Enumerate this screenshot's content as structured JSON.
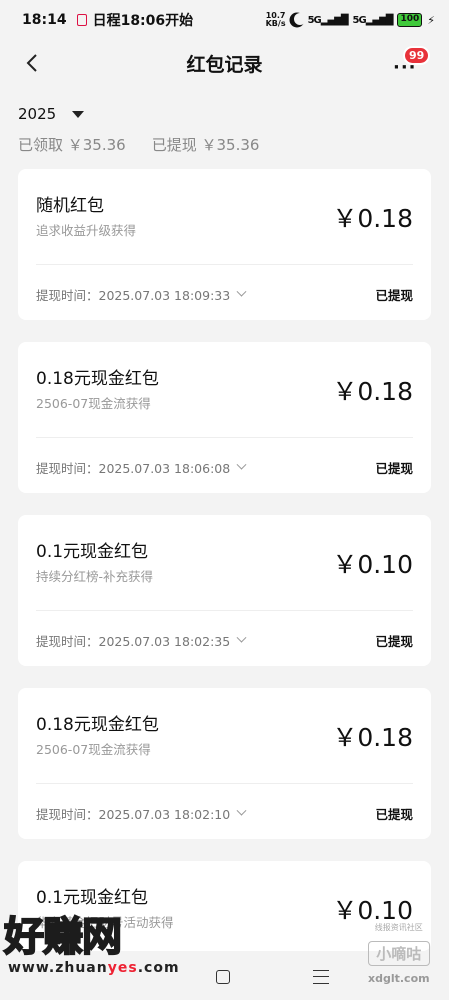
{
  "status_bar": {
    "time": "18:14",
    "notice": "日程18:06开始",
    "net_speed_value": "10.7",
    "net_speed_unit": "KB/s",
    "signal_1": "5G",
    "signal_2": "5G",
    "battery": "100"
  },
  "header": {
    "title": "红包记录",
    "badge_count": "99"
  },
  "filter": {
    "year": "2025"
  },
  "summary": {
    "received": "已领取 ￥35.36",
    "withdrawn": "已提现 ￥35.36"
  },
  "records": [
    {
      "title": "随机红包",
      "source": "追求收益升级获得",
      "amount": "￥0.18",
      "time": "提现时间：2025.07.03 18:09:33",
      "status": "已提现"
    },
    {
      "title": "0.18元现金红包",
      "source": "2506-07现金流获得",
      "amount": "￥0.18",
      "time": "提现时间：2025.07.03 18:06:08",
      "status": "已提现"
    },
    {
      "title": "0.1元现金红包",
      "source": "持续分红榜-补充获得",
      "amount": "￥0.10",
      "time": "提现时间：2025.07.03 18:02:35",
      "status": "已提现"
    },
    {
      "title": "0.18元现金红包",
      "source": "2506-07现金流获得",
      "amount": "￥0.18",
      "time": "提现时间：2025.07.03 18:02:10",
      "status": "已提现"
    },
    {
      "title": "0.1元现金红包",
      "source": "华安基金招财号活动获得",
      "amount": "￥0.10"
    }
  ],
  "watermark": {
    "left_title": "好赚网",
    "left_url_a": "www.zhuan",
    "left_url_b": "yes",
    "left_url_c": ".com",
    "right_top": "线报资讯社区",
    "right_name": "小嘀咕",
    "right_url": "xdglt.com"
  }
}
